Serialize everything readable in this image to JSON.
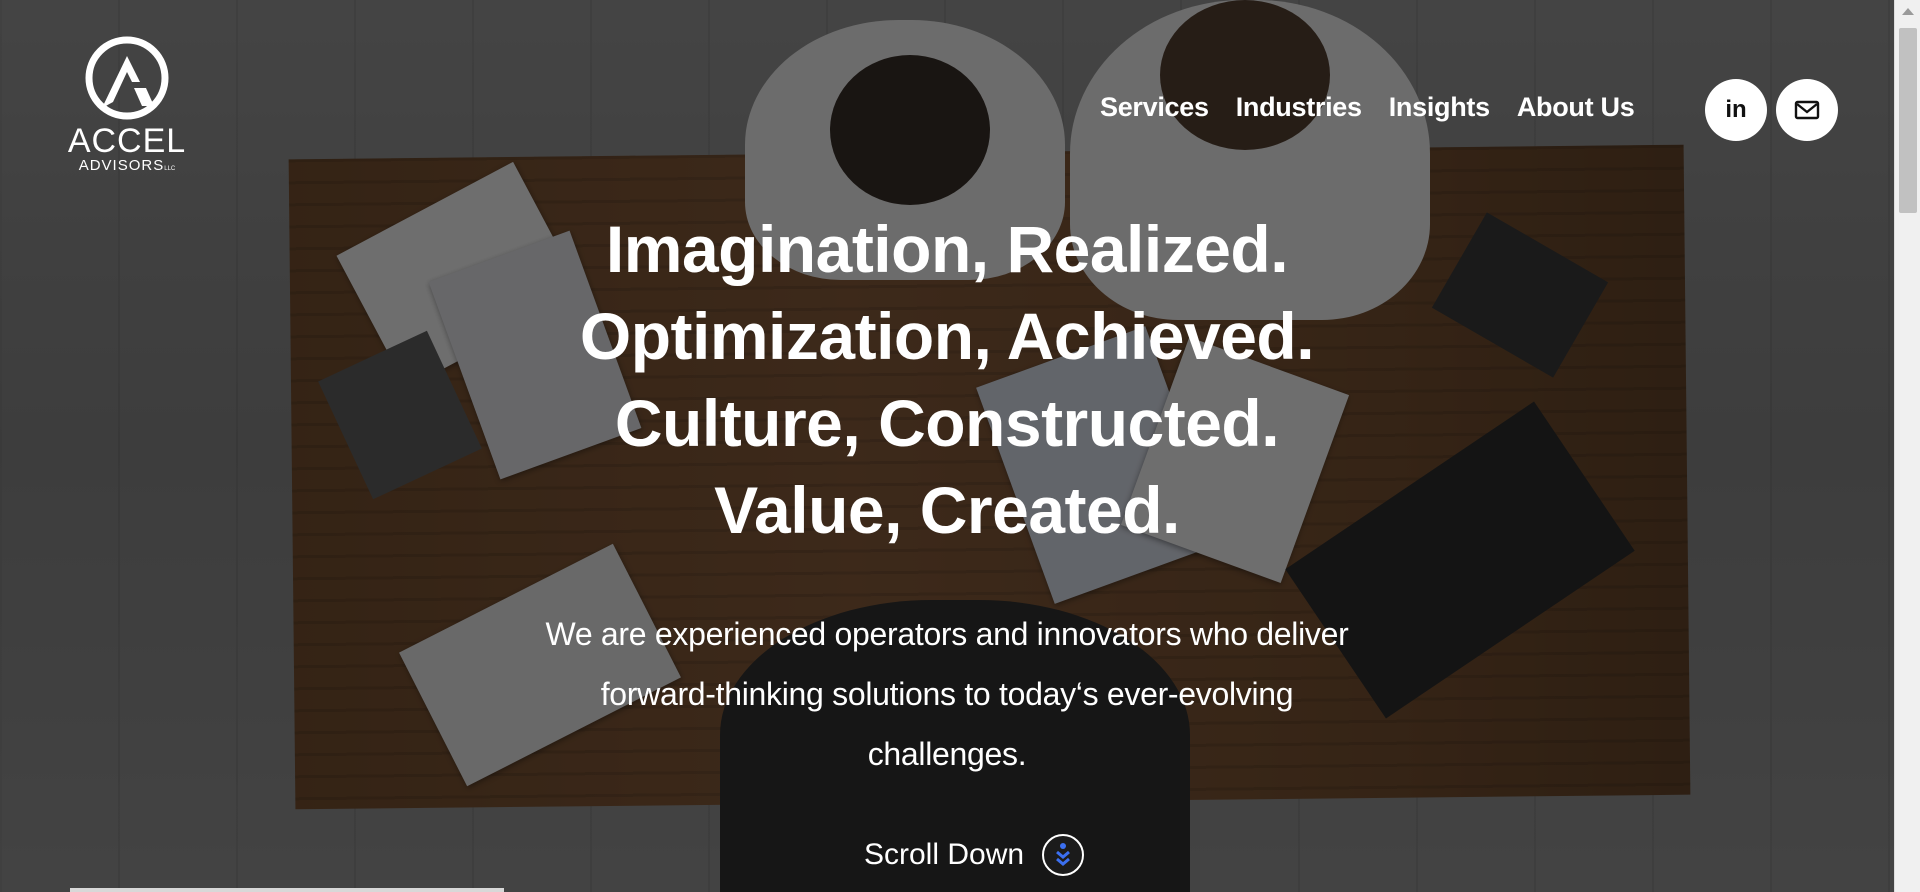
{
  "brand": {
    "name": "ACCEL",
    "sub": "ADVISORS",
    "suffix": "LLC"
  },
  "nav": {
    "items": [
      "Services",
      "Industries",
      "Insights",
      "About Us"
    ]
  },
  "social": {
    "linkedin_label": "in"
  },
  "hero": {
    "lines": [
      "Imagination, Realized.",
      "Optimization, Achieved.",
      "Culture, Constructed.",
      "Value, Created."
    ],
    "description": "We are experienced operators and innovators who deliver forward-thinking solutions to today‘s ever-evolving challenges.",
    "scroll_label": "Scroll Down"
  },
  "icons": {
    "logo": "accel-logo-icon",
    "linkedin": "linkedin-icon",
    "mail": "mail-icon",
    "scroll": "chevron-double-down-icon"
  },
  "colors": {
    "overlay": "#0a0a0a",
    "scroll_icon": "#3b6ff0",
    "text": "#ffffff"
  }
}
